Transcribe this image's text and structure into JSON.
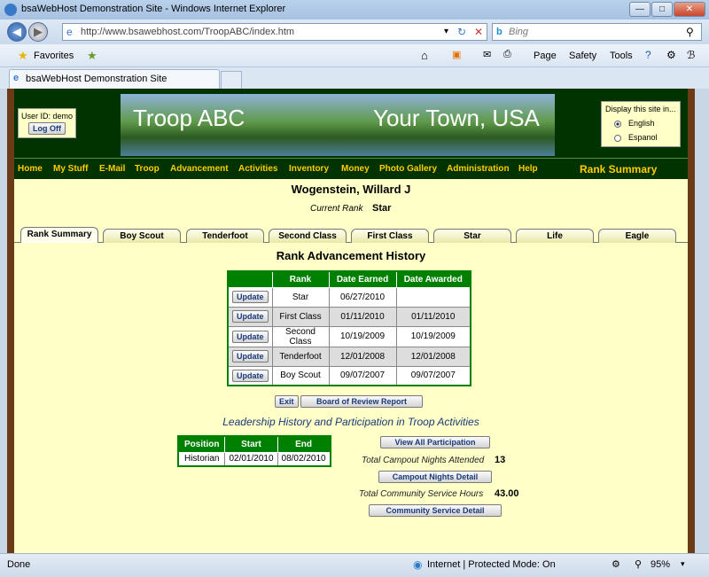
{
  "window": {
    "title": "bsaWebHost Demonstration Site - Windows Internet Explorer",
    "url": "http://www.bsawebhost.com/TroopABC/index.htm",
    "search_placeholder": "Bing",
    "favorites_label": "Favorites",
    "tab_title": "bsaWebHost Demonstration Site",
    "commands": [
      "Page",
      "Safety",
      "Tools"
    ]
  },
  "header": {
    "user_id_label": "User ID: demo",
    "logoff_label": "Log Off",
    "banner_left": "Troop ABC",
    "banner_right": "Your Town, USA",
    "lang_title": "Display this site in...",
    "lang_english": "English",
    "lang_spanish": "Espanol"
  },
  "nav": {
    "items": [
      "Home",
      "My Stuff",
      "E-Mail",
      "Troop",
      "Advancement",
      "Activities",
      "Inventory",
      "Money",
      "Photo Gallery",
      "Administration",
      "Help"
    ],
    "section_title": "Rank Summary"
  },
  "scout": {
    "name": "Wogenstein, Willard J",
    "current_rank_label": "Current Rank",
    "current_rank": "Star"
  },
  "tabs": [
    "Rank Summary",
    "Boy Scout",
    "Tenderfoot",
    "Second Class",
    "First Class",
    "Star",
    "Life",
    "Eagle"
  ],
  "rank_history": {
    "title": "Rank Advancement History",
    "columns": [
      "Rank",
      "Date Earned",
      "Date Awarded"
    ],
    "update_label": "Update",
    "rows": [
      {
        "rank": "Star",
        "earned": "06/27/2010",
        "awarded": ""
      },
      {
        "rank": "First Class",
        "earned": "01/11/2010",
        "awarded": "01/11/2010"
      },
      {
        "rank": "Second Class",
        "earned": "10/19/2009",
        "awarded": "10/19/2009"
      },
      {
        "rank": "Tenderfoot",
        "earned": "12/01/2008",
        "awarded": "12/01/2008"
      },
      {
        "rank": "Boy Scout",
        "earned": "09/07/2007",
        "awarded": "09/07/2007"
      }
    ],
    "exit_label": "Exit",
    "bor_label": "Board of Review Report"
  },
  "leadership": {
    "title": "Leadership History and Participation in Troop Activities",
    "columns": [
      "Position",
      "Start",
      "End"
    ],
    "rows": [
      {
        "position": "Historian",
        "start": "02/01/2010",
        "end": "08/02/2010"
      }
    ]
  },
  "participation": {
    "view_all_label": "View All Participation",
    "campout_label": "Total Campout Nights Attended",
    "campout_value": "13",
    "campout_detail_label": "Campout Nights Detail",
    "service_label": "Total Community Service Hours",
    "service_value": "43.00",
    "service_detail_label": "Community Service Detail"
  },
  "status": {
    "left": "Done",
    "zone": "Internet | Protected Mode: On",
    "zoom": "95%"
  }
}
